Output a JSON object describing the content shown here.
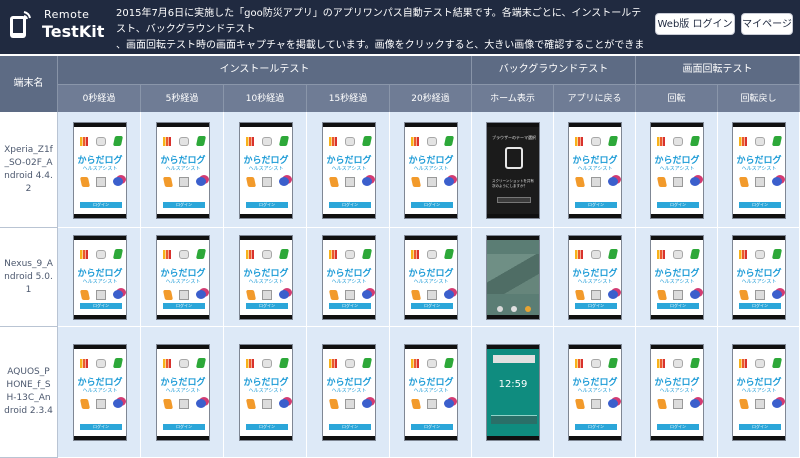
{
  "header": {
    "logo_line1": "Remote",
    "logo_line2": "TestKit",
    "headline": "2015年7月6日に実施した「goo防災アプリ」のアプリワンパス自動テスト結果です。各端末ごとに、インストールテスト、バックグラウンドテスト\n、画面回転テスト時の画面キャプチャを掲載しています。画像をクリックすると、大きい画像で確認することができます。",
    "web_login_label": "Web版 ログイン",
    "mypage_label": "マイページ"
  },
  "table": {
    "device_header": "端末名",
    "groups": [
      {
        "label": "インストールテスト",
        "span": 5
      },
      {
        "label": "バックグラウンドテスト",
        "span": 2
      },
      {
        "label": "画面回転テスト",
        "span": 2
      }
    ],
    "columns": [
      "0秒経過",
      "5秒経過",
      "10秒経過",
      "15秒経過",
      "20秒経過",
      "ホーム表示",
      "アプリに戻る",
      "回転",
      "回転戻し"
    ],
    "rows": [
      {
        "device": "Xperia_Z1f_SO-02F_Android 4.4.2",
        "home_variant": "dialog"
      },
      {
        "device": "Nexus_9_Android 5.0.1",
        "home_variant": "home"
      },
      {
        "device": "AQUOS_PHONE_f_SH-13C_Android 2.3.4",
        "home_variant": "home2"
      }
    ],
    "app_screen": {
      "title": "からだログ",
      "subtitle": "ヘルスアシスト",
      "button": "ログイン"
    },
    "home_screens": {
      "dialog_title": "ブラウザーのテーマ選択",
      "dialog_text": "スクリーンショットを共有\n次のようにしますか？",
      "clock": "12:59"
    }
  }
}
